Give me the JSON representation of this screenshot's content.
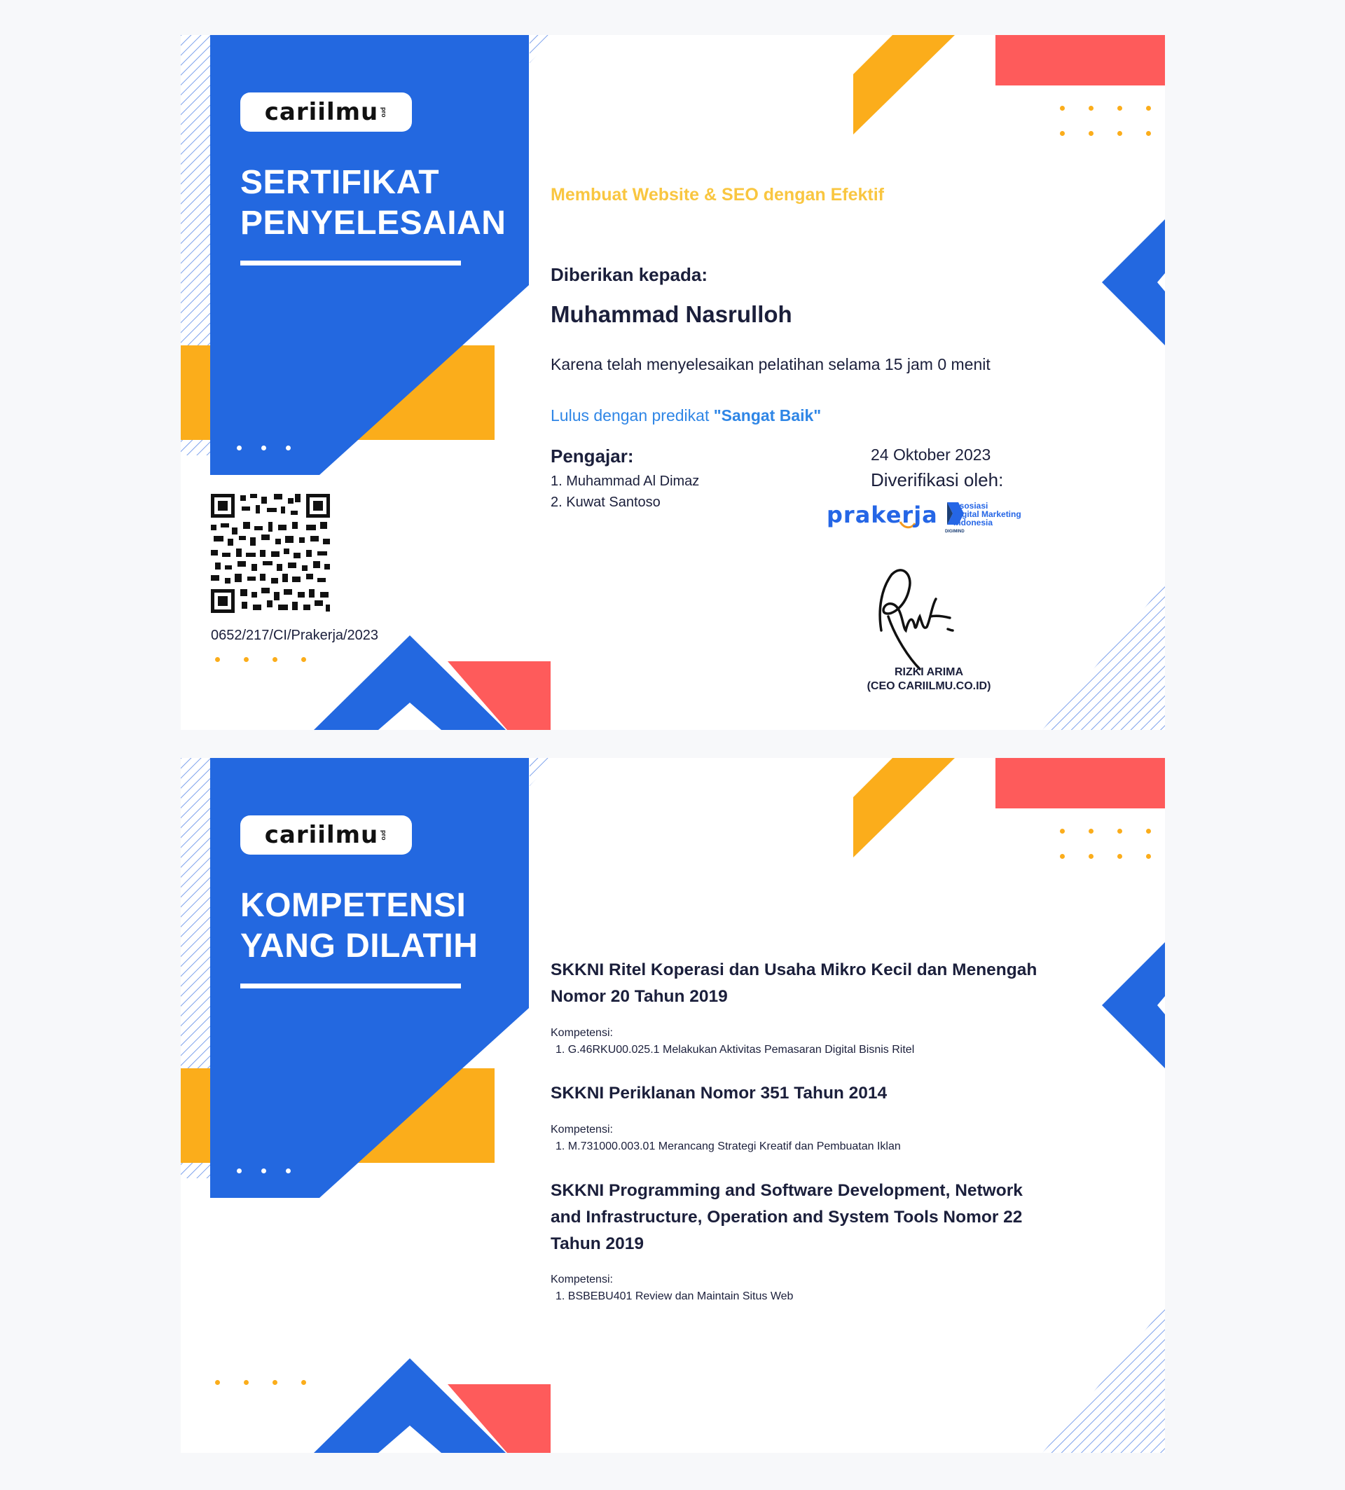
{
  "logo": {
    "text": "cariilmu",
    "sub": "pro"
  },
  "certificate": {
    "heading_line1": "SERTIFIKAT",
    "heading_line2": "PENYELESAIAN",
    "course_title": "Membuat Website & SEO dengan Efektif",
    "given_to_label": "Diberikan kepada:",
    "recipient_name": "Muhammad Nasrulloh",
    "reason_text": "Karena telah menyelesaikan pelatihan selama 15 jam 0 menit",
    "predicate_prefix": "Lulus dengan predikat ",
    "predicate_value": "\"Sangat Baik\"",
    "instructor_label": "Pengajar:",
    "instructors": [
      "1. Muhammad Al Dimaz",
      "2. Kuwat Santoso"
    ],
    "date": "24 Oktober 2023",
    "verified_label": "Diverifikasi oleh:",
    "verifier_prakerja": "prakerja",
    "verifier_adm": [
      "Asosiasi",
      "Digital Marketing",
      "Indonesia"
    ],
    "verifier_adm_small": "DIGIMIND",
    "signer_name": "RIZKI ARIMA",
    "signer_title": "(CEO CARIILMU.CO.ID)",
    "certificate_number": "0652/217/CI/Prakerja/2023"
  },
  "competency": {
    "heading_line1": "KOMPETENSI",
    "heading_line2": "YANG DILATIH",
    "groups": [
      {
        "title": "SKKNI Ritel Koperasi dan Usaha Mikro Kecil dan Menengah Nomor 20 Tahun 2019",
        "label": "Kompetensi:",
        "items": [
          "1. G.46RKU00.025.1 Melakukan Aktivitas Pemasaran Digital Bisnis Ritel"
        ]
      },
      {
        "title": "SKKNI Periklanan Nomor 351 Tahun 2014",
        "label": "Kompetensi:",
        "items": [
          "1. M.731000.003.01 Merancang Strategi Kreatif dan Pembuatan Iklan"
        ]
      },
      {
        "title": "SKKNI Programming and Software Development, Network and Infrastructure, Operation and System Tools Nomor 22 Tahun 2019",
        "label": "Kompetensi:",
        "items": [
          "1. BSBEBU401 Review dan Maintain Situs Web"
        ]
      }
    ]
  },
  "colors": {
    "blue": "#2368e0",
    "orange": "#fbad1b",
    "red": "#fe5b5b",
    "yellow": "#f9c640",
    "navy": "#1b1f3b"
  }
}
